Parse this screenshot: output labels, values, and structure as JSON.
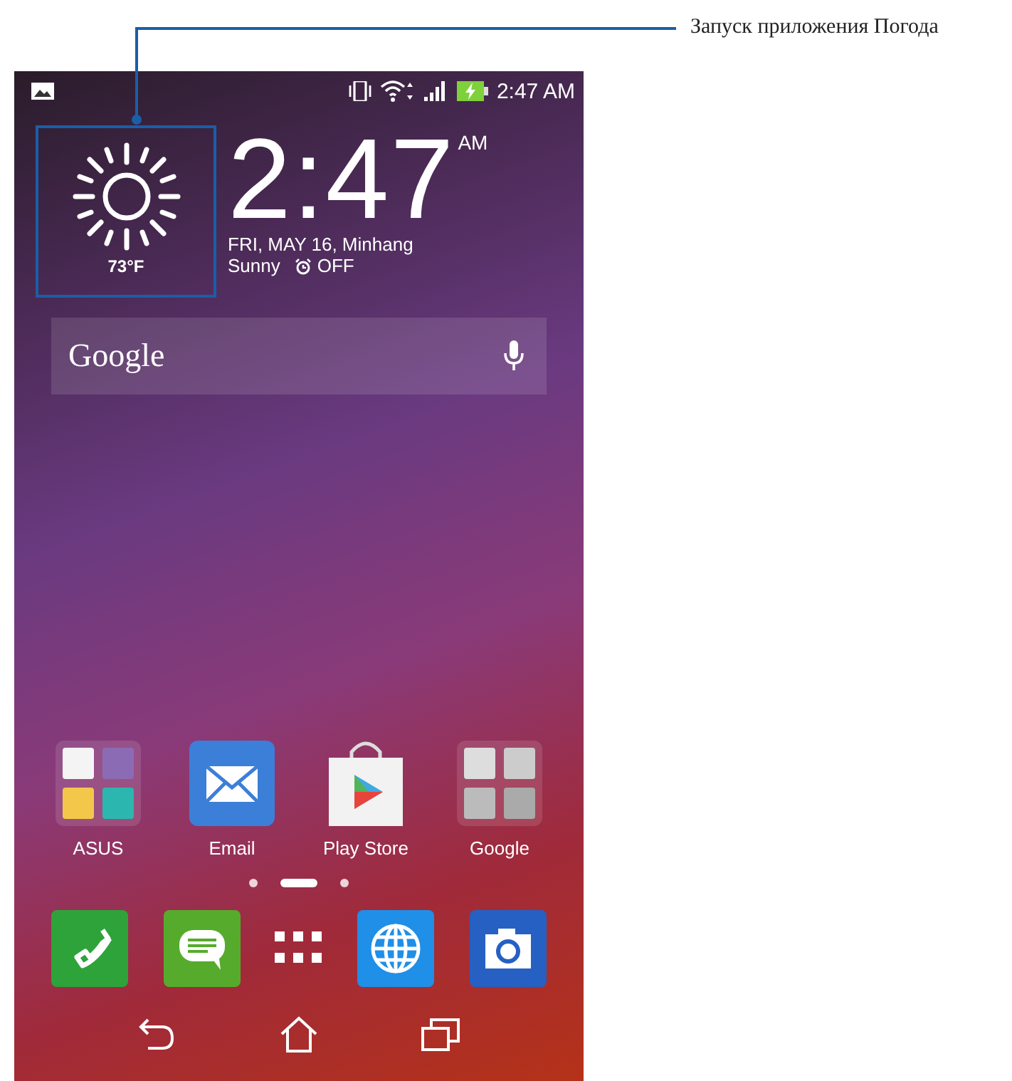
{
  "callout": {
    "label": "Запуск приложения Погода"
  },
  "status_bar": {
    "time": "2:47 AM"
  },
  "weather": {
    "temperature": "73°F"
  },
  "clock": {
    "time": "2:47",
    "period": "AM",
    "date": "FRI, MAY 16, Minhang",
    "condition": "Sunny",
    "alarm": "OFF"
  },
  "search": {
    "placeholder": "Google"
  },
  "apps": [
    {
      "label": "ASUS",
      "kind": "folder"
    },
    {
      "label": "Email",
      "kind": "mail"
    },
    {
      "label": "Play Store",
      "kind": "store"
    },
    {
      "label": "Google",
      "kind": "folder"
    }
  ],
  "page_indicator": [
    {
      "selected": false
    },
    {
      "selected": true
    },
    {
      "selected": false
    }
  ]
}
